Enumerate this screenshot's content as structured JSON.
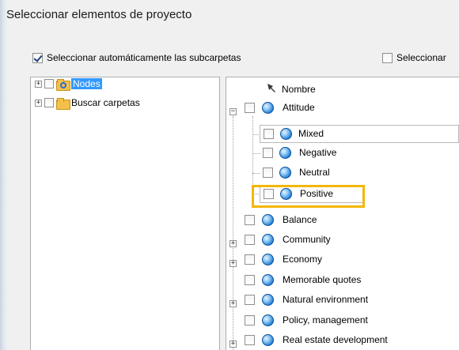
{
  "window": {
    "title": "Seleccionar elementos de proyecto"
  },
  "options": {
    "auto_subfolders": {
      "label": "Seleccionar automáticamente las subcarpetas",
      "checked": true
    },
    "second": {
      "label": "Seleccionar",
      "checked": false
    }
  },
  "left_tree": {
    "items": [
      {
        "label": "Nodes",
        "selected": true,
        "icon": "nodes-folder-icon"
      },
      {
        "label": "Buscar carpetas",
        "selected": false,
        "icon": "search-folder-icon"
      }
    ]
  },
  "right_list": {
    "column_header": "Nombre",
    "rows": [
      {
        "label": "Attitude",
        "expander": "−",
        "checked": false
      },
      {
        "label": "Mixed",
        "checked": false
      },
      {
        "label": "Negative",
        "checked": false
      },
      {
        "label": "Neutral",
        "checked": false
      },
      {
        "label": "Positive",
        "checked": false,
        "highlighted": true
      },
      {
        "label": "Balance",
        "checked": false
      },
      {
        "label": "Community",
        "expander": "+",
        "checked": false
      },
      {
        "label": "Economy",
        "expander": "+",
        "checked": false
      },
      {
        "label": "Memorable quotes",
        "checked": false
      },
      {
        "label": "Natural environment",
        "expander": "+",
        "checked": false
      },
      {
        "label": "Policy, management",
        "checked": false
      },
      {
        "label": "Real estate development",
        "expander": "+",
        "checked": false
      }
    ]
  },
  "colors": {
    "selection": "#3399ff",
    "highlight": "#f2b705",
    "node_icon": "#1f7dd6"
  }
}
